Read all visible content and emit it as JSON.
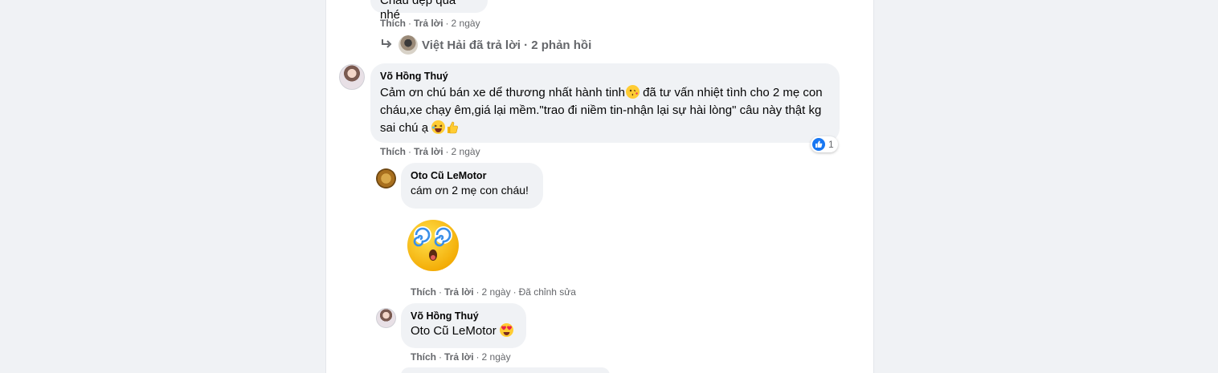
{
  "comments": [
    {
      "text_partial": "Cháu đẹp quá nhé",
      "actions": {
        "like": "Thích",
        "reply": "Trả lời",
        "time": "2 ngày"
      },
      "replies_link": {
        "text": "Việt Hải đã trả lời · 2 phản hồi"
      }
    },
    {
      "author": "Võ Hồng Thuý",
      "text_line1": "Cảm ơn chú bán xe dể thương nhất hành tinh",
      "text_line1b": " đã tư vấn nhiệt tình cho 2 mẹ con",
      "text_line2": "cháu,xe chạy êm,giá lại mềm.\"trao đi niềm tin-nhận lại sự hài lòng\" câu này thật kg",
      "text_line3": "sai chú ạ ",
      "reaction_count": "1",
      "actions": {
        "like": "Thích",
        "reply": "Trả lời",
        "time": "2 ngày"
      }
    }
  ],
  "replies": [
    {
      "author": "Oto Cũ LeMotor",
      "text": "cám ơn 2 mẹ con cháu!",
      "sticker": "dizzy-face-sticker",
      "actions": {
        "like": "Thích",
        "reply": "Trả lời",
        "time": "2 ngày",
        "edited": "Đã chỉnh sửa"
      }
    },
    {
      "author": "Võ Hồng Thuý",
      "text": "Oto Cũ LeMotor",
      "actions": {
        "like": "Thích",
        "reply": "Trả lời",
        "time": "2 ngày"
      }
    }
  ],
  "colors": {
    "like_blue": "#1877f2",
    "bubble_bg": "#f0f2f5",
    "secondary_text": "#65676b"
  },
  "icons": [
    "reply-arrow-icon",
    "kiss-emoji-icon",
    "laughing-emoji-icon",
    "thumbs-up-emoji-icon",
    "like-reaction-icon",
    "heart-eyes-emoji-icon"
  ]
}
